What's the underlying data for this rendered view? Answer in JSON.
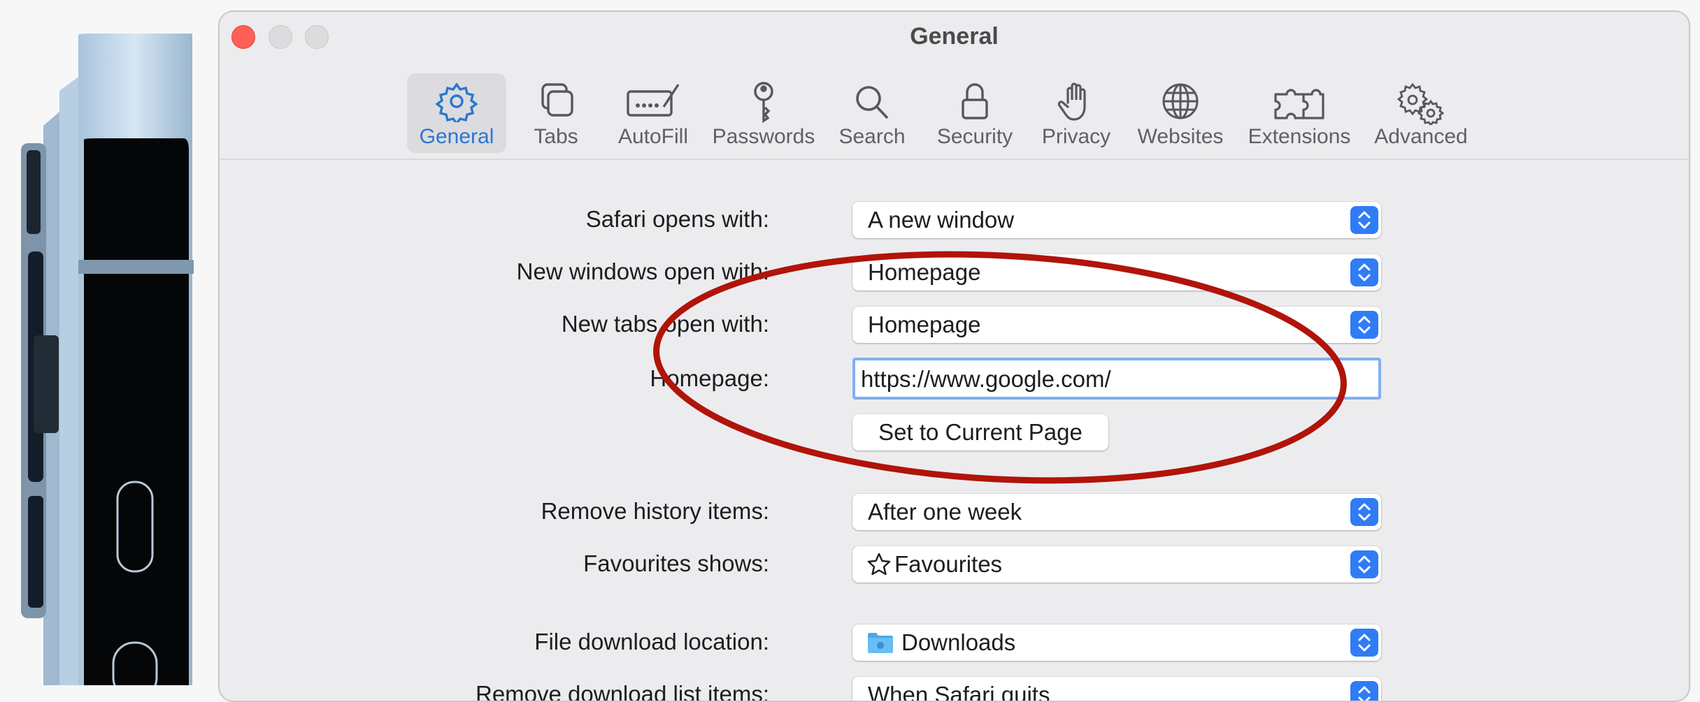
{
  "window": {
    "title": "General",
    "traffic_lights": {
      "close_color": "#fe5f57"
    }
  },
  "toolbar": {
    "active_color": "#2a76d2",
    "items": [
      {
        "label": "General",
        "icon": "gear-icon",
        "active": true
      },
      {
        "label": "Tabs",
        "icon": "tabs-icon",
        "active": false
      },
      {
        "label": "AutoFill",
        "icon": "autofill-icon",
        "active": false
      },
      {
        "label": "Passwords",
        "icon": "key-icon",
        "active": false
      },
      {
        "label": "Search",
        "icon": "magnifier-icon",
        "active": false
      },
      {
        "label": "Security",
        "icon": "lock-icon",
        "active": false
      },
      {
        "label": "Privacy",
        "icon": "hand-icon",
        "active": false
      },
      {
        "label": "Websites",
        "icon": "globe-icon",
        "active": false
      },
      {
        "label": "Extensions",
        "icon": "puzzle-icon",
        "active": false
      },
      {
        "label": "Advanced",
        "icon": "gears-icon",
        "active": false
      }
    ]
  },
  "general": {
    "safari_opens_with": {
      "label": "Safari opens with:",
      "value": "A new window"
    },
    "new_windows_open_with": {
      "label": "New windows open with:",
      "value": "Homepage"
    },
    "new_tabs_open_with": {
      "label": "New tabs open with:",
      "value": "Homepage"
    },
    "homepage": {
      "label": "Homepage:",
      "value": "https://www.google.com/"
    },
    "set_current_page_label": "Set to Current Page",
    "remove_history_items": {
      "label": "Remove history items:",
      "value": "After one week"
    },
    "favourites_shows": {
      "label": "Favourites shows:",
      "value": "Favourites",
      "icon": "star-icon"
    },
    "file_download_location": {
      "label": "File download location:",
      "value": "Downloads",
      "icon": "folder-icon"
    },
    "remove_download_list_items": {
      "label": "Remove download list items:",
      "value": "When Safari quits"
    }
  },
  "colors": {
    "accent": "#2f7cf6",
    "annotation": "#b0140a"
  }
}
